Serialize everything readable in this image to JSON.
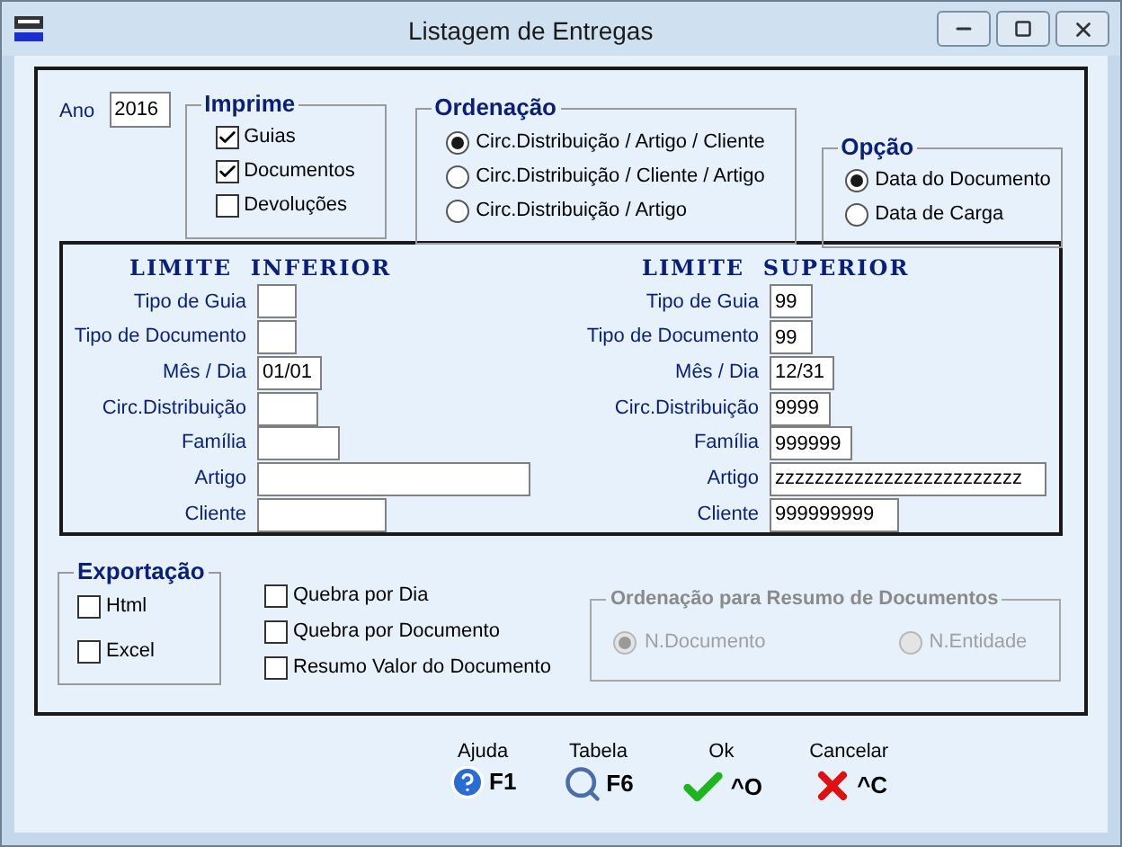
{
  "window": {
    "title": "Listagem de Entregas"
  },
  "ano": {
    "label": "Ano",
    "value": "2016"
  },
  "imprime": {
    "title": "Imprime",
    "items": [
      {
        "label": "Guias",
        "checked": true
      },
      {
        "label": "Documentos",
        "checked": true
      },
      {
        "label": "Devoluções",
        "checked": false
      }
    ]
  },
  "ordenacao": {
    "title": "Ordenação",
    "options": [
      {
        "label": "Circ.Distribuição / Artigo / Cliente",
        "selected": true
      },
      {
        "label": "Circ.Distribuição / Cliente / Artigo",
        "selected": false
      },
      {
        "label": "Circ.Distribuição / Artigo",
        "selected": false
      }
    ]
  },
  "opcao": {
    "title": "Opção",
    "options": [
      {
        "label": "Data do Documento",
        "selected": true
      },
      {
        "label": "Data de Carga",
        "selected": false
      }
    ]
  },
  "limite_inferior": {
    "title": "LIMITE  INFERIOR",
    "fields": [
      {
        "label": "Tipo de Guia"
      },
      {
        "label": "Tipo de Documento"
      },
      {
        "label": "Mês / Dia",
        "value": "01/01"
      },
      {
        "label": "Circ.Distribuição"
      },
      {
        "label": "Família"
      },
      {
        "label": "Artigo"
      },
      {
        "label": "Cliente"
      }
    ]
  },
  "limite_superior": {
    "title": "LIMITE  SUPERIOR",
    "fields": [
      {
        "label": "Tipo de Guia",
        "value": "99"
      },
      {
        "label": "Tipo de Documento",
        "value": "99"
      },
      {
        "label": "Mês / Dia",
        "value": "12/31"
      },
      {
        "label": "Circ.Distribuição",
        "value": "9999"
      },
      {
        "label": "Família",
        "value": "999999"
      },
      {
        "label": "Artigo",
        "value": "zzzzzzzzzzzzzzzzzzzzzzzzz"
      },
      {
        "label": "Cliente",
        "value": "999999999"
      }
    ]
  },
  "exportacao": {
    "title": "Exportação",
    "items": [
      {
        "label": "Html",
        "checked": false
      },
      {
        "label": "Excel",
        "checked": false
      }
    ]
  },
  "quebras": [
    {
      "label": "Quebra por Dia",
      "checked": false
    },
    {
      "label": "Quebra por Documento",
      "checked": false
    },
    {
      "label": "Resumo  Valor do Documento",
      "checked": false
    }
  ],
  "ordenacao_resumo": {
    "title": "Ordenação para Resumo de Documentos",
    "disabled": true,
    "options": [
      {
        "label": "N.Documento",
        "selected": true
      },
      {
        "label": "N.Entidade",
        "selected": false
      }
    ]
  },
  "buttons": [
    {
      "kind": "help",
      "label": "Ajuda",
      "key": "F1"
    },
    {
      "kind": "table",
      "label": "Tabela",
      "key": "F6"
    },
    {
      "kind": "ok",
      "label": "Ok",
      "key": "^O"
    },
    {
      "kind": "cancel",
      "label": "Cancelar",
      "key": "^C"
    }
  ]
}
